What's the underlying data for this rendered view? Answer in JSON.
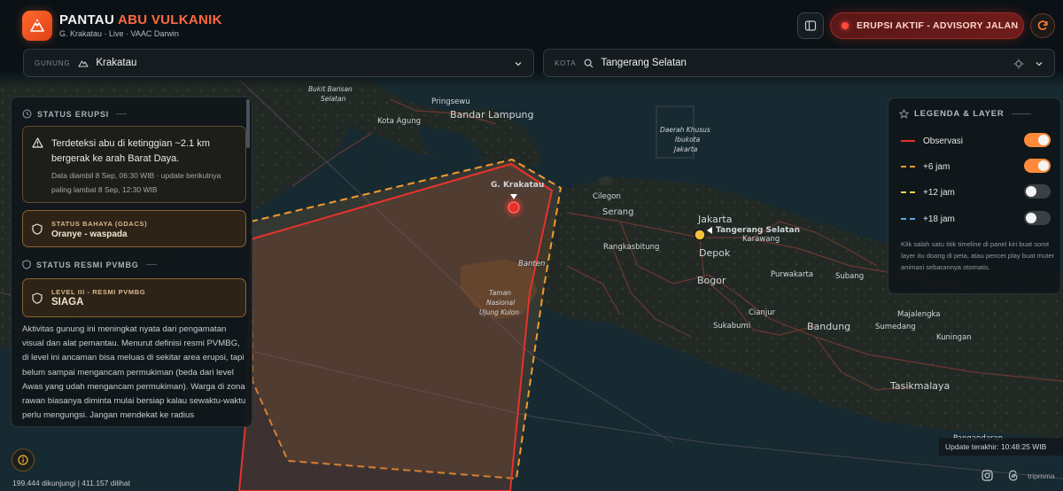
{
  "header": {
    "title_part1": "PANTAU",
    "title_part2": "ABU VULKANIK",
    "subtitle": "G. Krakatau · Live · VAAC Darwin",
    "alert_label": "ERUPSI AKTIF - ADVISORY JALAN",
    "alert_color": "#ff4a3a",
    "accent_color": "#ff6a3d"
  },
  "selectors": {
    "volcano": {
      "label": "GUNUNG",
      "value": "Krakatau"
    },
    "city": {
      "label": "KOTA",
      "value": "Tangerang Selatan"
    }
  },
  "status_panel": {
    "erupsi_heading": "STATUS ERUPSI",
    "detection_text": "Terdeteksi abu di ketinggian ~2.1 km bergerak ke arah Barat Daya.",
    "data_note": "Data diambil 8 Sep, 06:30 WIB · update berikutnya paling lambat 8 Sep, 12:30 WIB",
    "gdacs_caption": "STATUS BAHAYA (GDACS)",
    "gdacs_value": "Oranye - waspada",
    "pvmbg_heading": "STATUS RESMI PVMBG",
    "level_caption": "LEVEL III - RESMI PVMBG",
    "level_value": "SIAGA",
    "description": "Aktivitas gunung ini meningkat nyata dari pengamatan visual dan alat pemantau. Menurut definisi resmi PVMBG, di level ini ancaman bisa meluas di sekitar area erupsi, tapi belum sampai mengancam permukiman (beda dari level Awas yang udah mengancam permukiman). Warga di zona rawan biasanya diminta mulai bersiap kalau sewaktu-waktu perlu mengungsi. Jangan mendekat ke radius"
  },
  "legend": {
    "heading": "LEGENDA & LAYER",
    "items": [
      {
        "label": "Observasi",
        "color": "#e8322c",
        "style": "solid",
        "enabled": true
      },
      {
        "label": "+6 jam",
        "color": "#f29a2e",
        "style": "dashed",
        "enabled": true
      },
      {
        "label": "+12 jam",
        "color": "#f2d23a",
        "style": "dashed",
        "enabled": false
      },
      {
        "label": "+18 jam",
        "color": "#5aa6e6",
        "style": "dashed",
        "enabled": false
      }
    ],
    "note": "Klik salah satu titik timeline di panel kiri buat sorot layer itu doang di peta, atau pencet play buat muter animasi sebarannya otomatis."
  },
  "map": {
    "volcano_label": "G. Krakatau",
    "city_marker_label": "Tangerang Selatan",
    "place_labels": {
      "bukit_barisan": "Bukit Barisan",
      "selatan": "Selatan",
      "kota_agung": "Kota Agung",
      "pringsewu": "Pringsewu",
      "bandar_lampung": "Bandar Lampung",
      "daerah_khusus": "Daerah Khusus",
      "ibukota": "Ibukota",
      "jakarta_region": "Jakarta",
      "cilegon": "Cilegon",
      "serang": "Serang",
      "jakarta": "Jakarta",
      "rangkasbitung": "Rangkasbitung",
      "depok": "Depok",
      "karawang": "Karawang",
      "banten": "Banten",
      "bogor": "Bogor",
      "purwakarta": "Purwakarta",
      "subang": "Subang",
      "taman": "Taman",
      "nasional": "Nasional",
      "ujung_kulon": "Ujung Kulon",
      "cianjur": "Cianjur",
      "majalengka": "Majalengka",
      "sumedang": "Sumedang",
      "sukabumi": "Sukabumi",
      "bandung": "Bandung",
      "kuningan": "Kuningan",
      "tasikmalaya": "Tasikmalaya",
      "pangandaran": "Pangandaran"
    }
  },
  "footer": {
    "visits": "199.444 dikunjungi | 411.157 dilihat",
    "updated": "Update terakhir: 10:48:25 WIB",
    "trip": "tripmma"
  }
}
